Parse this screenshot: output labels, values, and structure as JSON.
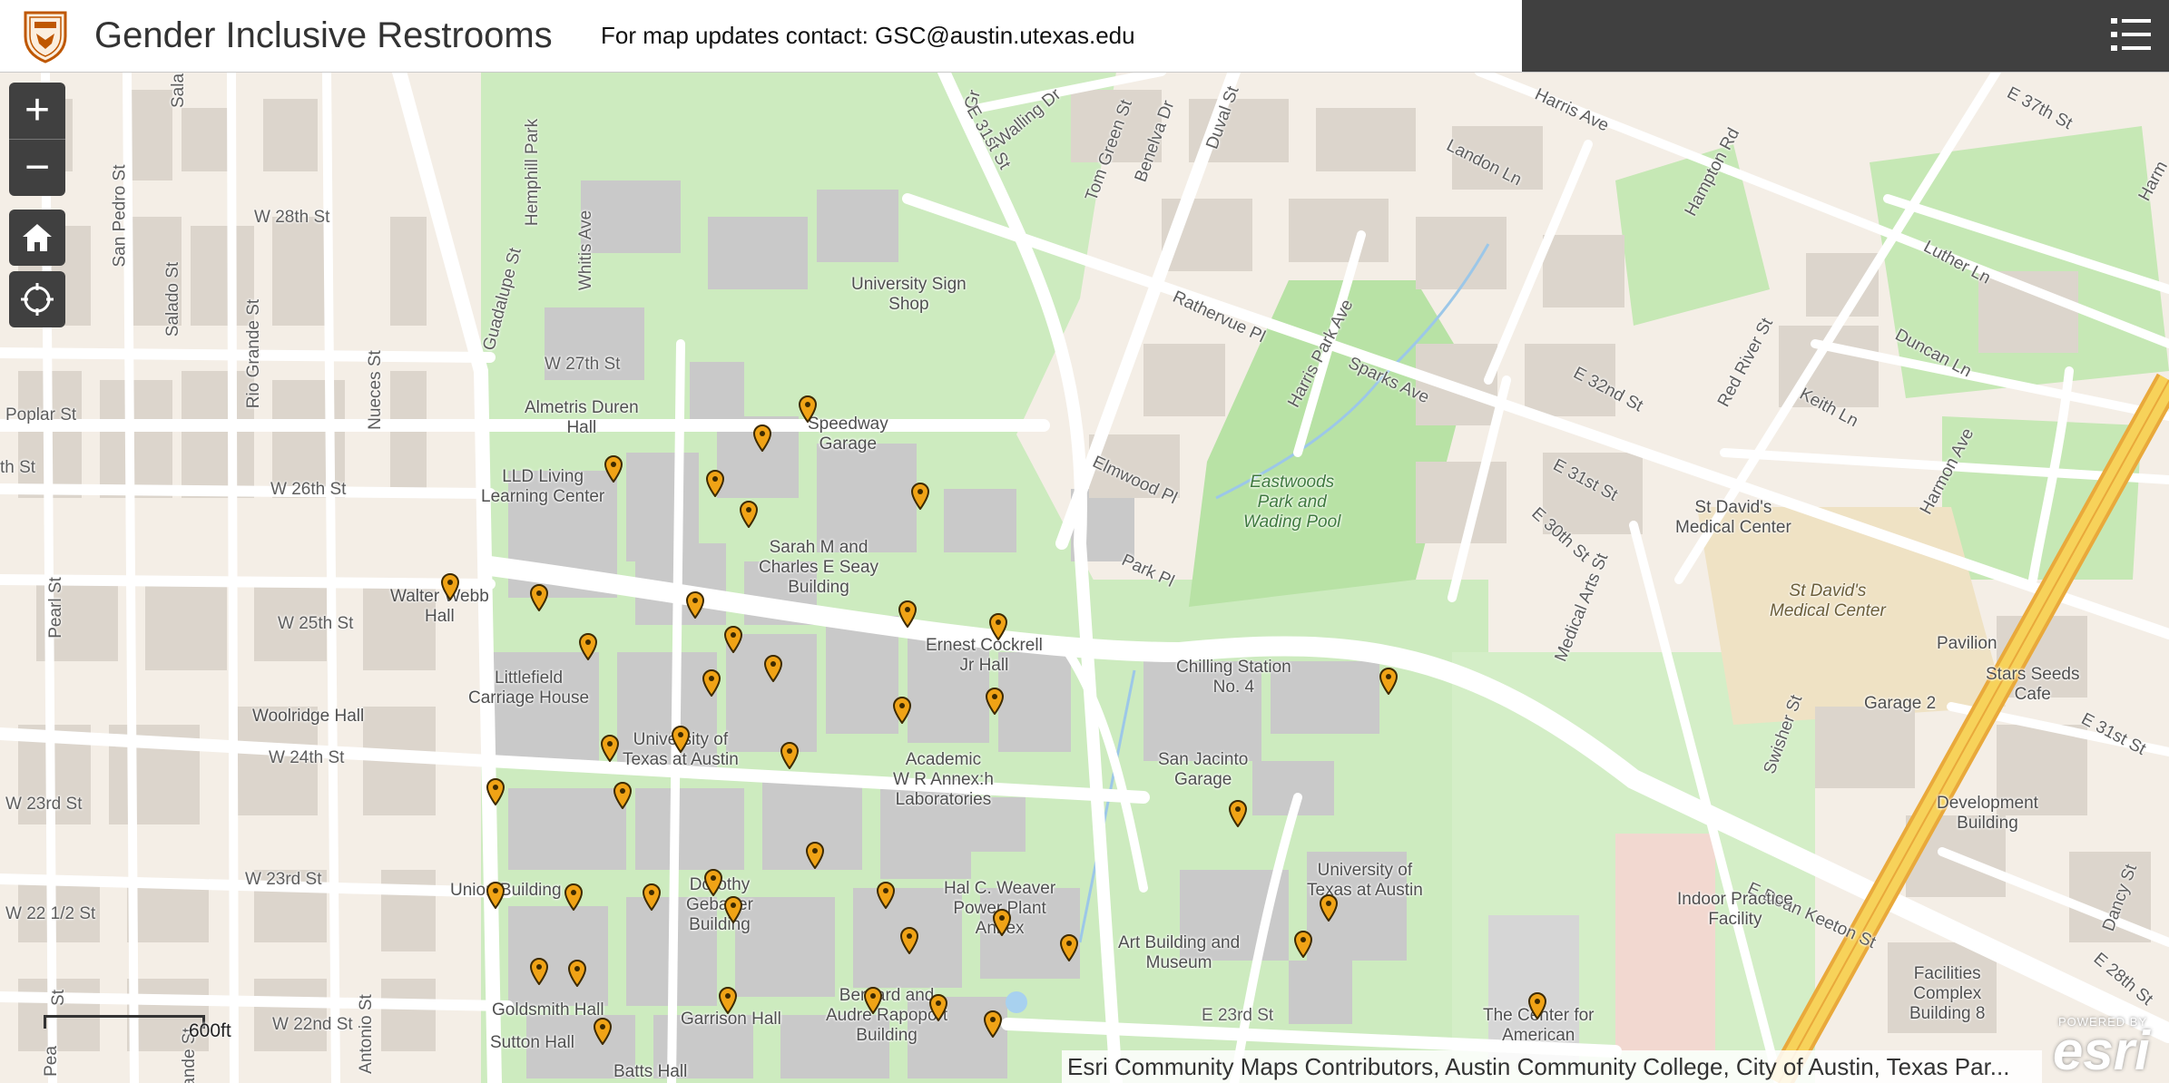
{
  "header": {
    "title": "Gender Inclusive Restrooms",
    "contact": "For map updates contact: GSC@austin.utexas.edu",
    "logo_icon": "ut-shield-icon",
    "menu_icon": "list-menu-icon"
  },
  "colors": {
    "header_dark": "#404040",
    "marker_fill": "#f0a316",
    "park_green": "#c6e8b5",
    "highway": "#f7d25a",
    "map_background": "#f4eee6"
  },
  "controls": {
    "zoom_in": "+",
    "zoom_out": "−",
    "home_icon": "home-icon",
    "locate_icon": "locate-icon"
  },
  "map": {
    "streets": {
      "harris_ave_n": "Harris Ave",
      "e_37th": "E 37th St",
      "landon": "Landon Ln",
      "hampton": "Hampton Rd",
      "w_28th": "W 28th St",
      "hemphill": "Hemphill Park",
      "whitis": "Whitis Ave",
      "san_pedro": "San Pedro St",
      "salado": "Salado St",
      "sala": "Sala",
      "rio_grande": "Rio Grande St",
      "nueces": "Nueces St",
      "guadalupe": "Guadalupe St",
      "e_31st_top": "E 31st St",
      "walling": "Walling Dr",
      "tom_green": "Tom Green St",
      "benelva": "Benelva Dr",
      "duval": "Duval St",
      "gr": "Gr",
      "harm": "Harm",
      "luther": "Luther Ln",
      "duncan": "Duncan Ln",
      "keith": "Keith Ln",
      "red_river": "Red River St",
      "harmon": "Harmon Ave",
      "rathervue": "Rathervue Pl",
      "harris_park": "Harris Park Ave",
      "sparks": "Sparks Ave",
      "e_32nd": "E 32nd St",
      "w_27th": "W 27th St",
      "poplar": "Poplar St",
      "th_st": "th St",
      "elmwood": "Elmwood Pl",
      "e_31st": "E 31st St",
      "e_30th": "E 30th St",
      "medical_arts": "Medical Arts St",
      "park_pl": "Park Pl",
      "w_26th": "W 26th St",
      "w_25th": "W 25th St",
      "pearl": "Pearl St",
      "w_24th": "W 24th St",
      "w_23rd_left": "W 23rd St",
      "w_23rd": "W 23rd St",
      "w_22half": "W 22 1/2 St",
      "w_22nd": "W 22nd St",
      "e_23rd": "E 23rd St",
      "e_dean_keeton": "E Dean Keeton St",
      "swisher": "Swisher St",
      "e_31st_right": "E 31st St",
      "dancy": "Dancy St",
      "e_28th": "E 28th St",
      "pea": "Pea",
      "st_v": "St",
      "antonio": "Antonio St",
      "ande": "ande St"
    },
    "places": {
      "univ_sign_shop": "University Sign\nShop",
      "almetris": "Almetris Duren\nHall",
      "speedway_garage": "Speedway\nGarage",
      "lld": "LLD Living\nLearning Center",
      "seay": "Sarah M and\nCharles E Seay\nBuilding",
      "walter_webb": "Walter Webb\nHall",
      "cockrell": "Ernest Cockrell\nJr Hall",
      "chilling": "Chilling Station\nNo. 4",
      "littlefield": "Littlefield\nCarriage House",
      "woolridge": "Woolridge Hall",
      "ut_austin_1": "University of\nTexas at Austin",
      "academic_annex": "Academic\nW R Annex:h\nLaboratories",
      "san_jacinto": "San Jacinto\nGarage",
      "union": "Union Building",
      "gebauer": "Dorothy\nGebauer\nBuilding",
      "weaver": "Hal C. Weaver\nPower Plant\nAnnex",
      "ut_austin_2": "University of\nTexas at Austin",
      "art_building": "Art Building and\nMuseum",
      "goldsmith": "Goldsmith Hall",
      "garrison": "Garrison Hall",
      "kapoor": "Bernard and\nAudre Rapoport\nBuilding",
      "sutton": "Sutton Hall",
      "batts": "Batts Hall",
      "center_american": "The Center for\nAmerican",
      "st_davids_1": "St David's\nMedical Center",
      "pavilion": "Pavilion",
      "stars_seeds": "Stars Seeds\nCafe",
      "garage_2": "Garage 2",
      "development": "Development\nBuilding",
      "indoor_practice": "Indoor Practice\nFacility",
      "facilities": "Facilities\nComplex\nBuilding 8"
    },
    "parks": {
      "eastwoods": "Eastwoods\nPark and\nWading Pool"
    },
    "hospital": {
      "st_davids_2": "St David's\nMedical Center"
    },
    "markers": [
      {
        "id": 1,
        "lon_lat": [
          0.377,
          0.4
        ]
      },
      {
        "id": 2
      },
      {
        "id": 3
      },
      {
        "id": 4
      },
      {
        "id": 5
      },
      {
        "id": 6
      },
      {
        "id": 7
      },
      {
        "id": 8
      },
      {
        "id": 9
      },
      {
        "id": 10
      },
      {
        "id": 11
      },
      {
        "id": 12
      },
      {
        "id": 13
      },
      {
        "id": 14
      },
      {
        "id": 15
      },
      {
        "id": 16
      },
      {
        "id": 17
      },
      {
        "id": 18
      },
      {
        "id": 19
      },
      {
        "id": 20
      },
      {
        "id": 21
      },
      {
        "id": 22
      },
      {
        "id": 23
      },
      {
        "id": 24
      },
      {
        "id": 25
      },
      {
        "id": 26
      },
      {
        "id": 27
      },
      {
        "id": 28
      },
      {
        "id": 29
      },
      {
        "id": 30
      },
      {
        "id": 31
      },
      {
        "id": 32
      },
      {
        "id": 33
      },
      {
        "id": 34
      },
      {
        "id": 35
      },
      {
        "id": 36
      },
      {
        "id": 37
      },
      {
        "id": 38
      },
      {
        "id": 39
      },
      {
        "id": 40
      },
      {
        "id": 41
      },
      {
        "id": 42
      },
      {
        "id": 43
      },
      {
        "id": 44
      }
    ]
  },
  "scale": {
    "label": "600ft"
  },
  "attribution": "Esri Community Maps Contributors, Austin Community College, City of Austin, Texas Par...",
  "esri": {
    "powered": "POWERED BY",
    "word": "esri"
  }
}
